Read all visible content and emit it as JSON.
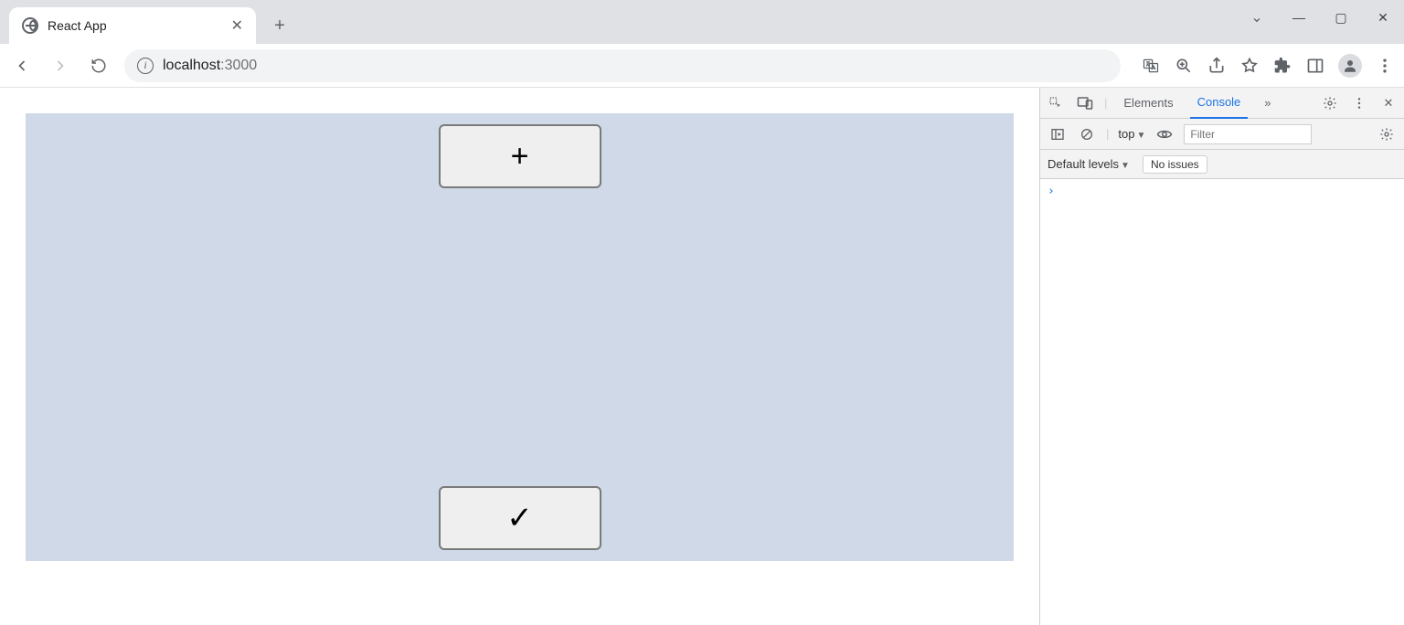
{
  "browser": {
    "tab_title": "React App",
    "url_host": "localhost",
    "url_port": ":3000",
    "window_controls": {
      "chevron": "⌄",
      "minimize": "—",
      "maximize": "▢",
      "close": "✕"
    }
  },
  "page": {
    "add_label": "+",
    "submit_label": "✓"
  },
  "devtools": {
    "tabs": {
      "elements": "Elements",
      "console": "Console",
      "more": "»"
    },
    "top_context": "top",
    "filter_placeholder": "Filter",
    "levels_label": "Default levels",
    "issues_label": "No issues",
    "prompt": "›"
  }
}
